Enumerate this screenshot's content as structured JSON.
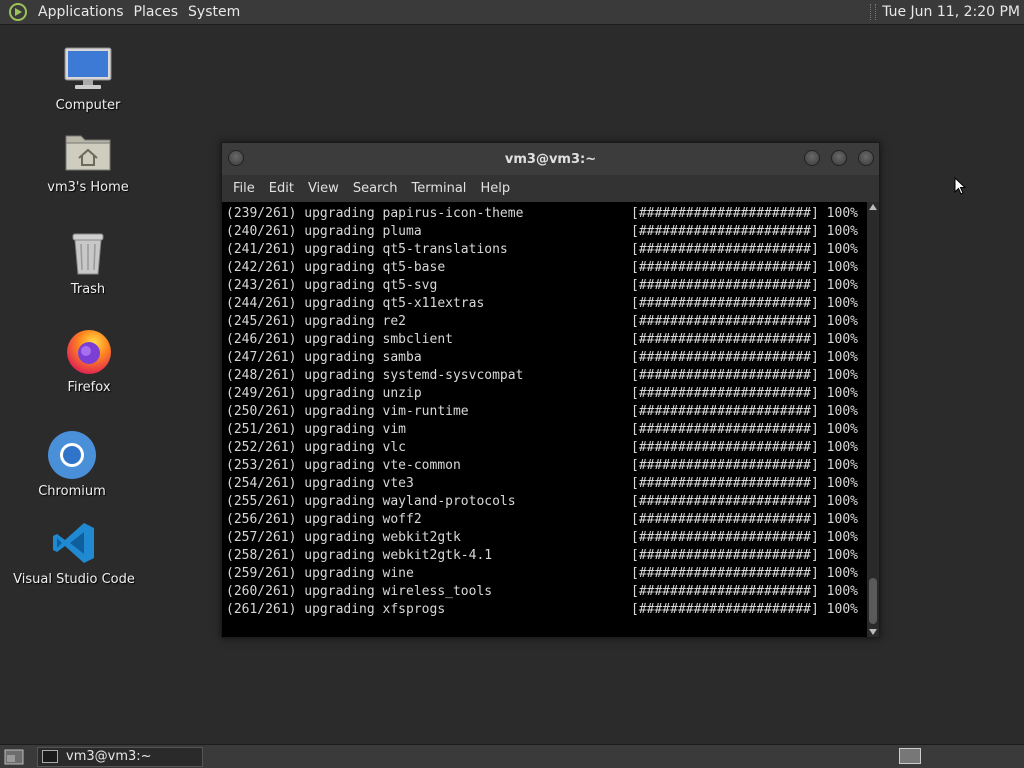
{
  "top_panel": {
    "menus": [
      "Applications",
      "Places",
      "System"
    ],
    "clock": "Tue Jun 11,  2:20 PM"
  },
  "desktop": {
    "icons": [
      {
        "label": "Computer",
        "icon": "computer-icon"
      },
      {
        "label": "vm3's Home",
        "icon": "home-folder-icon"
      },
      {
        "label": "Trash",
        "icon": "trash-icon"
      },
      {
        "label": "Firefox",
        "icon": "firefox-icon"
      },
      {
        "label": "Chromium",
        "icon": "chromium-icon"
      },
      {
        "label": "Visual Studio Code",
        "icon": "vscode-icon"
      }
    ]
  },
  "terminal": {
    "title": "vm3@vm3:~",
    "menu": [
      "File",
      "Edit",
      "View",
      "Search",
      "Terminal",
      "Help"
    ],
    "lines": [
      {
        "left": "(239/261) upgrading papirus-icon-theme",
        "right": "[######################] 100%"
      },
      {
        "left": "(240/261) upgrading pluma",
        "right": "[######################] 100%"
      },
      {
        "left": "(241/261) upgrading qt5-translations",
        "right": "[######################] 100%"
      },
      {
        "left": "(242/261) upgrading qt5-base",
        "right": "[######################] 100%"
      },
      {
        "left": "(243/261) upgrading qt5-svg",
        "right": "[######################] 100%"
      },
      {
        "left": "(244/261) upgrading qt5-x11extras",
        "right": "[######################] 100%"
      },
      {
        "left": "(245/261) upgrading re2",
        "right": "[######################] 100%"
      },
      {
        "left": "(246/261) upgrading smbclient",
        "right": "[######################] 100%"
      },
      {
        "left": "(247/261) upgrading samba",
        "right": "[######################] 100%"
      },
      {
        "left": "(248/261) upgrading systemd-sysvcompat",
        "right": "[######################] 100%"
      },
      {
        "left": "(249/261) upgrading unzip",
        "right": "[######################] 100%"
      },
      {
        "left": "(250/261) upgrading vim-runtime",
        "right": "[######################] 100%"
      },
      {
        "left": "(251/261) upgrading vim",
        "right": "[######################] 100%"
      },
      {
        "left": "(252/261) upgrading vlc",
        "right": "[######################] 100%"
      },
      {
        "left": "(253/261) upgrading vte-common",
        "right": "[######################] 100%"
      },
      {
        "left": "(254/261) upgrading vte3",
        "right": "[######################] 100%"
      },
      {
        "left": "(255/261) upgrading wayland-protocols",
        "right": "[######################] 100%"
      },
      {
        "left": "(256/261) upgrading woff2",
        "right": "[######################] 100%"
      },
      {
        "left": "(257/261) upgrading webkit2gtk",
        "right": "[######################] 100%"
      },
      {
        "left": "(258/261) upgrading webkit2gtk-4.1",
        "right": "[######################] 100%"
      },
      {
        "left": "(259/261) upgrading wine",
        "right": "[######################] 100%"
      },
      {
        "left": "(260/261) upgrading wireless_tools",
        "right": "[######################] 100%"
      },
      {
        "left": "(261/261) upgrading xfsprogs",
        "right": "[######################] 100%"
      }
    ]
  },
  "bottom_panel": {
    "task_label": "vm3@vm3:~"
  }
}
